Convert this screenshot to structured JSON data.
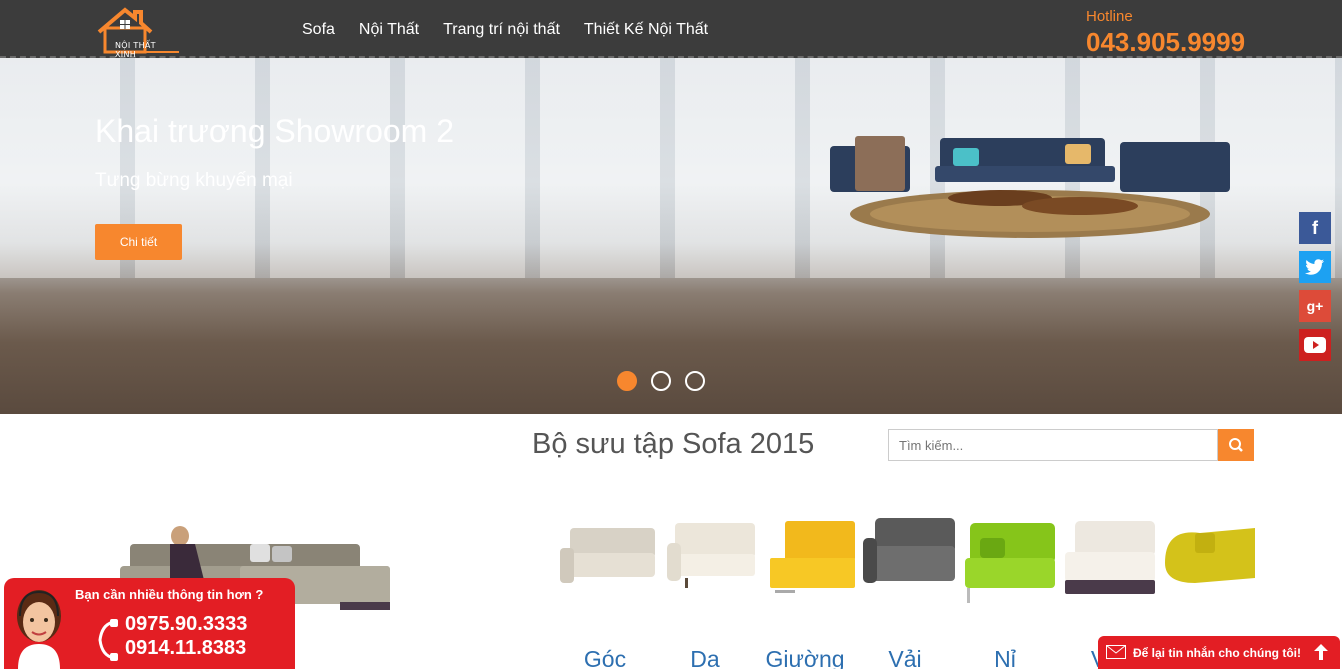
{
  "header": {
    "logo_text": "NỘI THẤT XINH",
    "nav": [
      "Sofa",
      "Nội Thất",
      "Trang trí nội thất",
      "Thiết Kế Nội Thất"
    ],
    "hotline_label": "Hotline",
    "hotline_number": "043.905.9999"
  },
  "hero": {
    "title": "Khai trương Showroom 2",
    "subtitle": "Tưng bừng khuyến mại",
    "button": "Chi tiết",
    "slides": 3,
    "active_slide": 1
  },
  "social": [
    "facebook-icon",
    "twitter-icon",
    "google-plus-icon",
    "youtube-icon"
  ],
  "section": {
    "title": "Bộ sưu tập Sofa  2015",
    "search_placeholder": "Tìm kiếm..."
  },
  "categories": [
    "Góc",
    "Da",
    "Giường",
    "Vải",
    "Nỉ",
    "Vă",
    ""
  ],
  "contact": {
    "question": "Bạn cần nhiều thông tin hơn ?",
    "phone1": "0975.90.3333",
    "phone2": "0914.11.8383"
  },
  "message": "Để lại tin nhắn cho chúng tôi!",
  "colors": {
    "accent": "#f7872e",
    "header": "#3c3c3c",
    "red": "#e31e24",
    "link": "#2d6fb0"
  }
}
